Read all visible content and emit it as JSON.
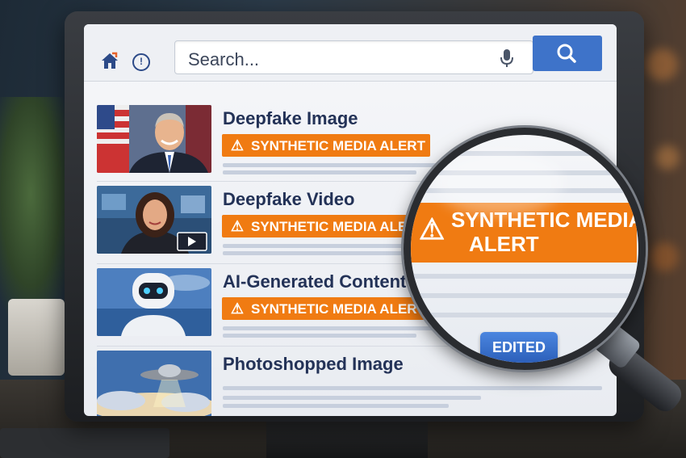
{
  "search": {
    "placeholder": "Search...",
    "mic_icon": "microphone-icon",
    "button_icon": "search-icon"
  },
  "toolbar": {
    "home_icon": "home-icon",
    "history_icon": "history-icon"
  },
  "items": [
    {
      "title": "Deepfake Image",
      "alert": "SYNTHETIC MEDIA ALERT",
      "thumb": "politician-flag"
    },
    {
      "title": "Deepfake Video",
      "alert": "SYNTHETIC MEDIA ALERT",
      "thumb": "news-anchor-video"
    },
    {
      "title": "AI-Generated Content",
      "alert": "SYNTHETIC MEDIA ALERT",
      "thumb": "robot"
    },
    {
      "title": "Photoshopped Image",
      "thumb": "ufo-sky"
    }
  ],
  "magnifier": {
    "alert_line1": "SYNTHETIC MEDIA",
    "alert_line2": "ALERT",
    "badge": "EDITED"
  },
  "colors": {
    "alert": "#f07b12",
    "accent": "#3e73c9",
    "title": "#233257"
  }
}
